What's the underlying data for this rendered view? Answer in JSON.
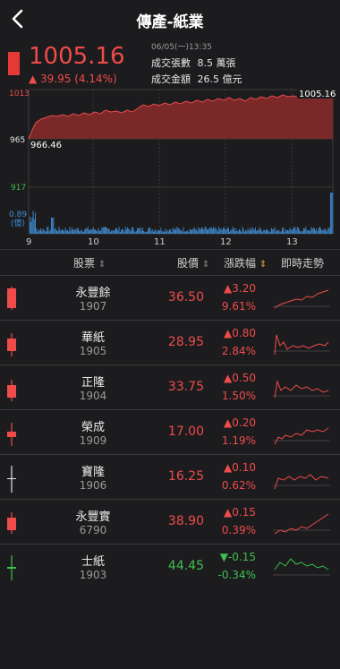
{
  "header": {
    "title": "傳產-紙業"
  },
  "index": {
    "price": "1005.16",
    "change": "▲ 39.95 (4.14%)",
    "date": "06/05(一)13:35",
    "volume_label": "成交張數",
    "volume_value": "8.5 萬張",
    "amount_label": "成交金額",
    "amount_value": "26.5 億元"
  },
  "chart_labels": {
    "y_top": "1013",
    "y_mid": "965",
    "y_low": "917",
    "vol_max": "0.89",
    "vol_unit": "(億)",
    "last_value": "1005.16",
    "open_value": "966.46",
    "x_ticks": [
      "9",
      "10",
      "11",
      "12",
      "13"
    ]
  },
  "colors": {
    "up": "#ef4b4b",
    "down": "#3fbf4f",
    "volume": "#3f8ed6",
    "chart_fill": "#8b2a2a"
  },
  "table": {
    "headers": {
      "stock": "股票",
      "price": "股價",
      "change": "漲跌幅",
      "trend": "即時走勢"
    },
    "rows": [
      {
        "name": "永豐餘",
        "code": "1907",
        "price": "36.50",
        "change": "▲3.20",
        "pct": "9.61%",
        "dir": "up"
      },
      {
        "name": "華紙",
        "code": "1905",
        "price": "28.95",
        "change": "▲0.80",
        "pct": "2.84%",
        "dir": "up"
      },
      {
        "name": "正隆",
        "code": "1904",
        "price": "33.75",
        "change": "▲0.50",
        "pct": "1.50%",
        "dir": "up"
      },
      {
        "name": "榮成",
        "code": "1909",
        "price": "17.00",
        "change": "▲0.20",
        "pct": "1.19%",
        "dir": "up"
      },
      {
        "name": "寶隆",
        "code": "1906",
        "price": "16.25",
        "change": "▲0.10",
        "pct": "0.62%",
        "dir": "up"
      },
      {
        "name": "永豐實",
        "code": "6790",
        "price": "38.90",
        "change": "▲0.15",
        "pct": "0.39%",
        "dir": "up"
      },
      {
        "name": "士紙",
        "code": "1903",
        "price": "44.45",
        "change": "▼-0.15",
        "pct": "-0.34%",
        "dir": "down"
      }
    ]
  }
}
